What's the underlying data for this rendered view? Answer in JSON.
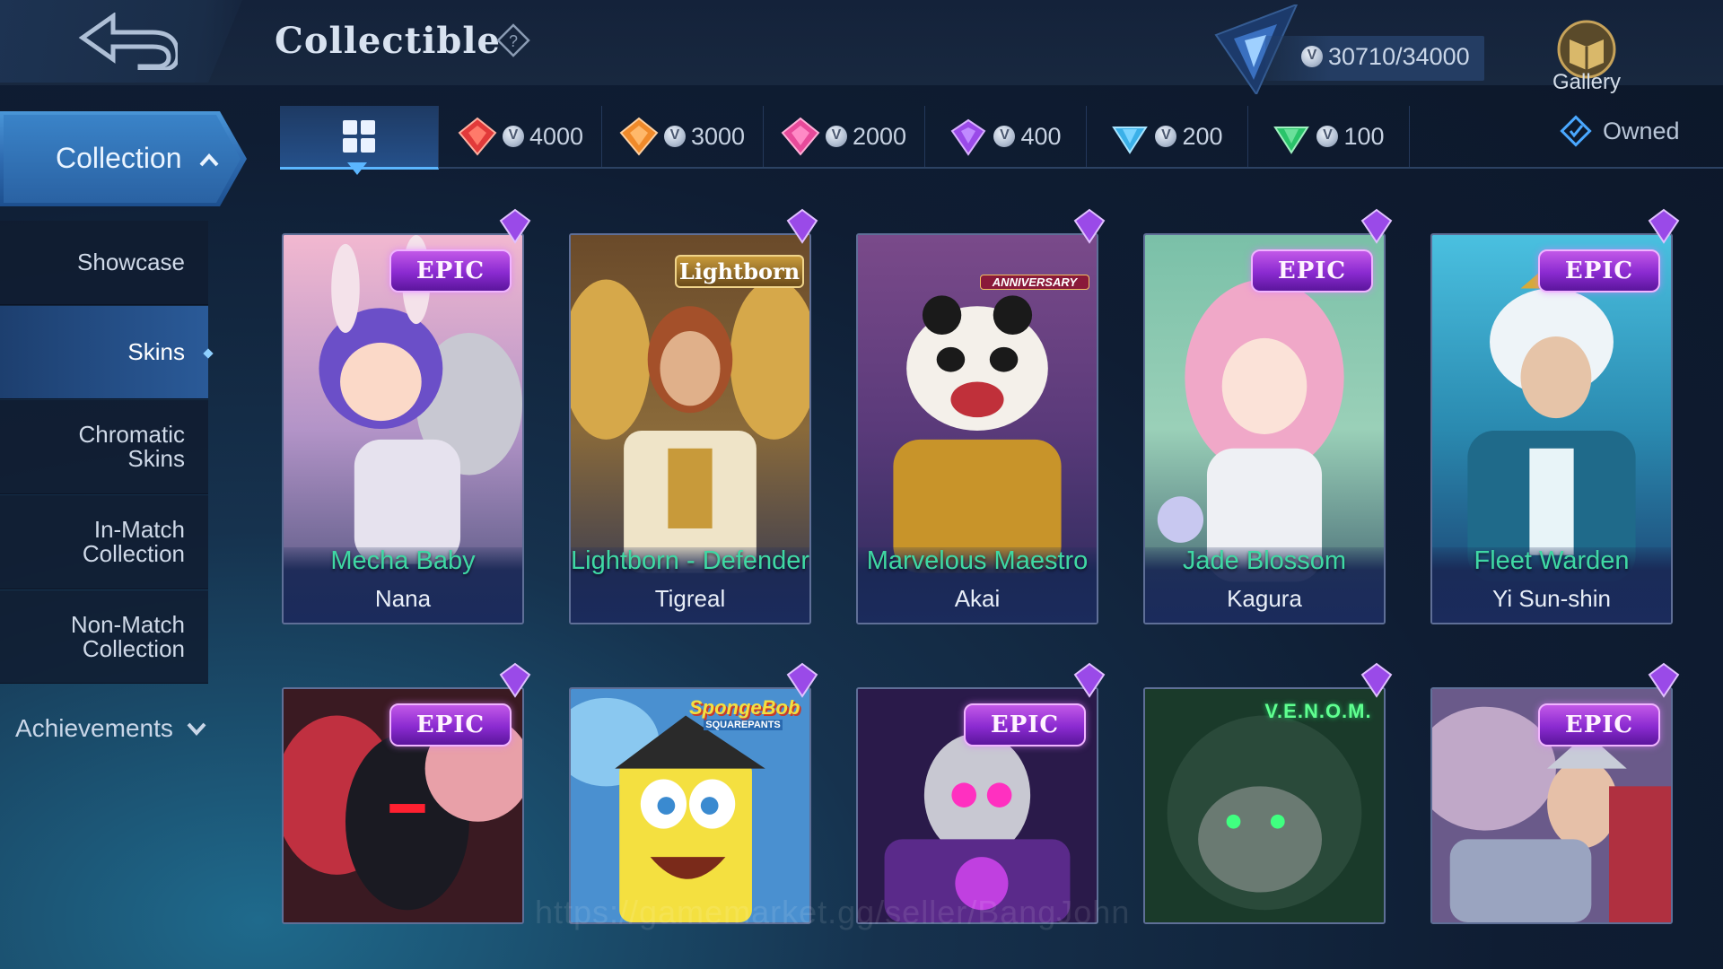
{
  "header": {
    "title": "Collectible",
    "points": "30710/34000",
    "gallery_label": "Gallery"
  },
  "tabs": [
    {
      "id": "all",
      "icon": "grid-icon",
      "label": ""
    },
    {
      "id": "t4000",
      "icon": "red-gem-icon",
      "label": "4000",
      "color": "#e23a3a"
    },
    {
      "id": "t3000",
      "icon": "orange-gem-icon",
      "label": "3000",
      "color": "#f08a2a"
    },
    {
      "id": "t2000",
      "icon": "pink-gem-icon",
      "label": "2000",
      "color": "#e84a9a"
    },
    {
      "id": "t400",
      "icon": "purple-gem-icon",
      "label": "400",
      "color": "#9a4ae8"
    },
    {
      "id": "t200",
      "icon": "blue-gem-icon",
      "label": "200",
      "color": "#3ab0e8"
    },
    {
      "id": "t100",
      "icon": "green-gem-icon",
      "label": "100",
      "color": "#2ac46a"
    }
  ],
  "owned_label": "Owned",
  "sidebar": {
    "collection_label": "Collection",
    "items": [
      {
        "label": "Showcase"
      },
      {
        "label": "Skins"
      },
      {
        "label": "Chromatic\nSkins"
      },
      {
        "label": "In-Match\nCollection"
      },
      {
        "label": "Non-Match\nCollection"
      }
    ],
    "achievements_label": "Achievements"
  },
  "cards": [
    {
      "skin": "Mecha Baby",
      "hero": "Nana",
      "badge": "EPIC"
    },
    {
      "skin": "Lightborn - Defender",
      "hero": "Tigreal",
      "badge": "Lightborn"
    },
    {
      "skin": "Marvelous Maestro",
      "hero": "Akai",
      "badge": "ANNIVERSARY"
    },
    {
      "skin": "Jade Blossom",
      "hero": "Kagura",
      "badge": "EPIC"
    },
    {
      "skin": "Fleet Warden",
      "hero": "Yi Sun-shin",
      "badge": "EPIC"
    },
    {
      "skin": "",
      "hero": "",
      "badge": "EPIC"
    },
    {
      "skin": "",
      "hero": "",
      "badge": "SpongeBob"
    },
    {
      "skin": "",
      "hero": "",
      "badge": "EPIC"
    },
    {
      "skin": "",
      "hero": "",
      "badge": "V.E.N.O.M."
    },
    {
      "skin": "",
      "hero": "",
      "badge": "EPIC"
    }
  ],
  "card_logo_subtexts": {
    "spongebob_sub": "SQUAREPANTS"
  },
  "watermark": "https://gamemarket.gg/seller/BangJohn",
  "colors": {
    "accent": "#3fd8a4",
    "epic": "#a23ae0",
    "selected_tab": "#25508a"
  }
}
